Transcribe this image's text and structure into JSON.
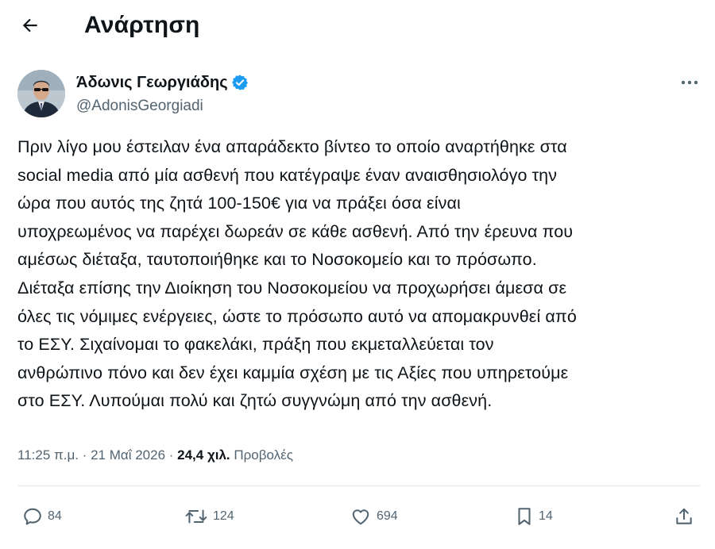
{
  "header": {
    "back_icon": "arrow-left-icon",
    "title": "Ανάρτηση"
  },
  "post": {
    "author": {
      "name": "Άδωνις Γεωργιάδης",
      "handle": "@AdonisGeorgiadi",
      "verified": true,
      "verified_color": "#1d9bf0"
    },
    "text_lines": [
      "Πριν λίγο μου έστειλαν ένα απαράδεκτο βίντεο το οποίο αναρτήθηκε στα",
      "social media από μία ασθενή που κατέγραψε έναν αναισθησιολόγο την",
      "ώρα που αυτός της ζητά 100-150€ για να πράξει όσα είναι",
      "υποχρεωμένος να παρέχει δωρεάν σε κάθε ασθενή. Από την έρευνα που",
      "αμέσως διέταξα, ταυτοποιήθηκε και το Νοσοκομείο και το πρόσωπο.",
      "Διέταξα επίσης την Διοίκηση του Νοσοκομείου να προχωρήσει άμεσα σε",
      "όλες τις νόμιμες ενέργειες, ώστε το πρόσωπο αυτό να απομακρυνθεί από",
      "το ΕΣΥ. Σιχαίνομαι το φακελάκι, πράξη που εκμεταλλεύεται τον",
      "ανθρώπινο πόνο και δεν έχει καμμία σχέση με τις Αξίες που υπηρετούμε",
      "στο ΕΣΥ. Λυπούμαι πολύ και ζητώ συγγνώμη από την ασθενή."
    ],
    "timestamp": "11:25 π.μ. · 21 Μαΐ 2026 · ",
    "views_count": "24,4 χιλ.",
    "views_label": " Προβολές"
  },
  "actions": {
    "replies": {
      "icon": "reply-icon",
      "count": "84"
    },
    "reposts": {
      "icon": "repost-icon",
      "count": "124"
    },
    "likes": {
      "icon": "heart-icon",
      "count": "694"
    },
    "bookmarks": {
      "icon": "bookmark-icon",
      "count": "14"
    },
    "share": {
      "icon": "share-icon"
    }
  },
  "colors": {
    "text": "#0f1419",
    "secondary": "#536471",
    "divider": "#e7e9ea",
    "verified": "#1d9bf0"
  }
}
